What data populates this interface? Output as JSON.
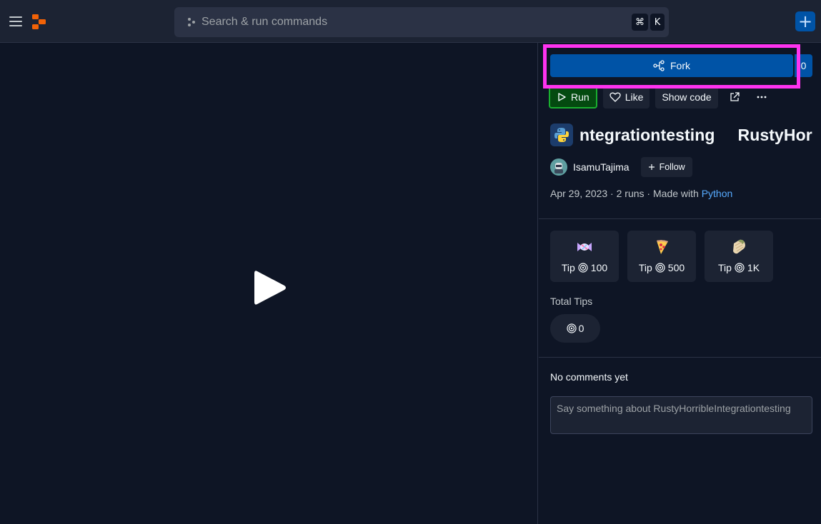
{
  "topbar": {
    "search_placeholder": "Search & run commands",
    "shortcut_keys": [
      "⌘",
      "K"
    ],
    "create_label": "+"
  },
  "repl": {
    "fork_label": "Fork",
    "fork_count": "0",
    "actions": {
      "run": "Run",
      "like": "Like",
      "show_code": "Show code"
    },
    "title_parts": [
      "ntegrationtesting",
      "RustyHor"
    ],
    "language_icon": "python-icon",
    "author": "IsamuTajima",
    "follow_label": "Follow",
    "meta": {
      "date": "Apr 29, 2023",
      "sep1": " · ",
      "runs": "2 runs",
      "sep2": " · ",
      "made_with": "Made with ",
      "language": "Python"
    }
  },
  "tips": {
    "cards": [
      {
        "icon": "candy-icon",
        "label": "Tip",
        "amount": "100"
      },
      {
        "icon": "pizza-icon",
        "label": "Tip",
        "amount": "500"
      },
      {
        "icon": "burrito-icon",
        "label": "Tip",
        "amount": "1K"
      }
    ],
    "total_label": "Total Tips",
    "total_value": "0"
  },
  "comments": {
    "empty_text": "No comments yet",
    "placeholder": "Say something about RustyHorribleIntegrationtesting"
  },
  "colors": {
    "background": "#0e1525",
    "surface": "#1c2333",
    "accent_blue": "#0053a6",
    "run_green": "#1ab02f",
    "link_blue": "#57abff",
    "highlight": "#ff33f0"
  }
}
